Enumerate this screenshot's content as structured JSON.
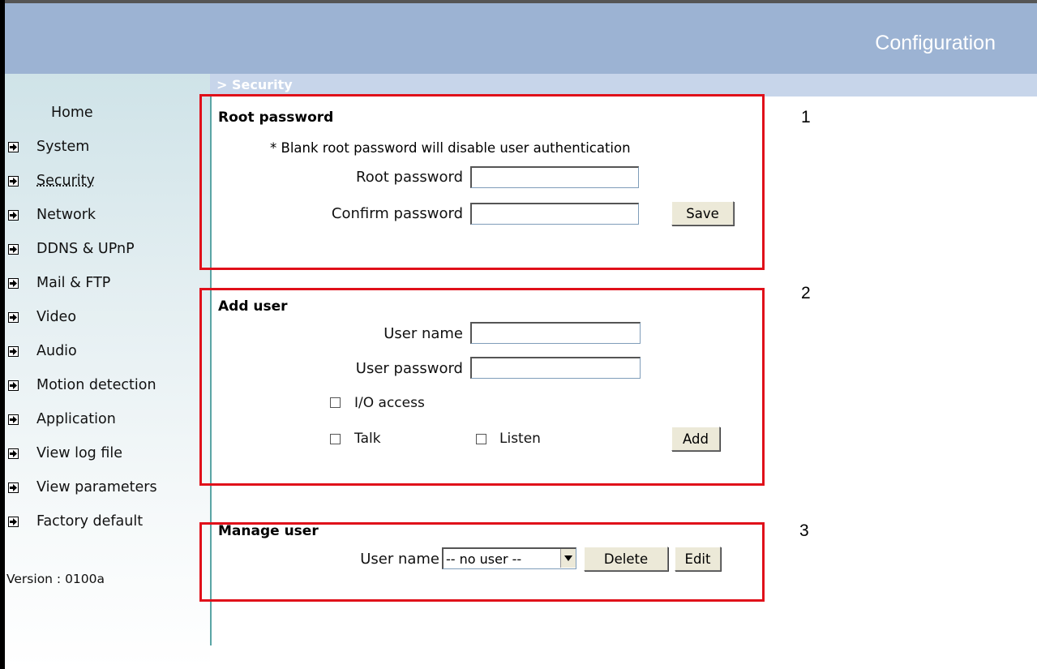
{
  "header": {
    "title": "Configuration"
  },
  "breadcrumb": "> Security",
  "sidebar": {
    "items": [
      {
        "label": "Home",
        "arrow": false
      },
      {
        "label": "System",
        "arrow": true
      },
      {
        "label": "Security",
        "arrow": true,
        "active": true
      },
      {
        "label": "Network",
        "arrow": true
      },
      {
        "label": "DDNS & UPnP",
        "arrow": true
      },
      {
        "label": "Mail & FTP",
        "arrow": true
      },
      {
        "label": "Video",
        "arrow": true
      },
      {
        "label": "Audio",
        "arrow": true
      },
      {
        "label": "Motion detection",
        "arrow": true
      },
      {
        "label": "Application",
        "arrow": true
      },
      {
        "label": "View log file",
        "arrow": true
      },
      {
        "label": "View parameters",
        "arrow": true
      },
      {
        "label": "Factory default",
        "arrow": true
      }
    ],
    "version": "Version : 0100a"
  },
  "root_password": {
    "title": "Root password",
    "note": "* Blank root password will disable user authentication",
    "root_label": "Root password",
    "confirm_label": "Confirm password",
    "save_label": "Save"
  },
  "add_user": {
    "title": "Add user",
    "user_name_label": "User name",
    "user_password_label": "User password",
    "io_access_label": "I/O access",
    "talk_label": "Talk",
    "listen_label": "Listen",
    "add_label": "Add"
  },
  "manage_user": {
    "title": "Manage user",
    "user_name_label": "User name",
    "selected_user": "-- no user --",
    "delete_label": "Delete",
    "edit_label": "Edit"
  },
  "markers": [
    "1",
    "2",
    "3"
  ],
  "colors": {
    "header": "#9cb3d3",
    "annotation": "#e0101a",
    "sidebar_line": "#5aa5a5"
  }
}
